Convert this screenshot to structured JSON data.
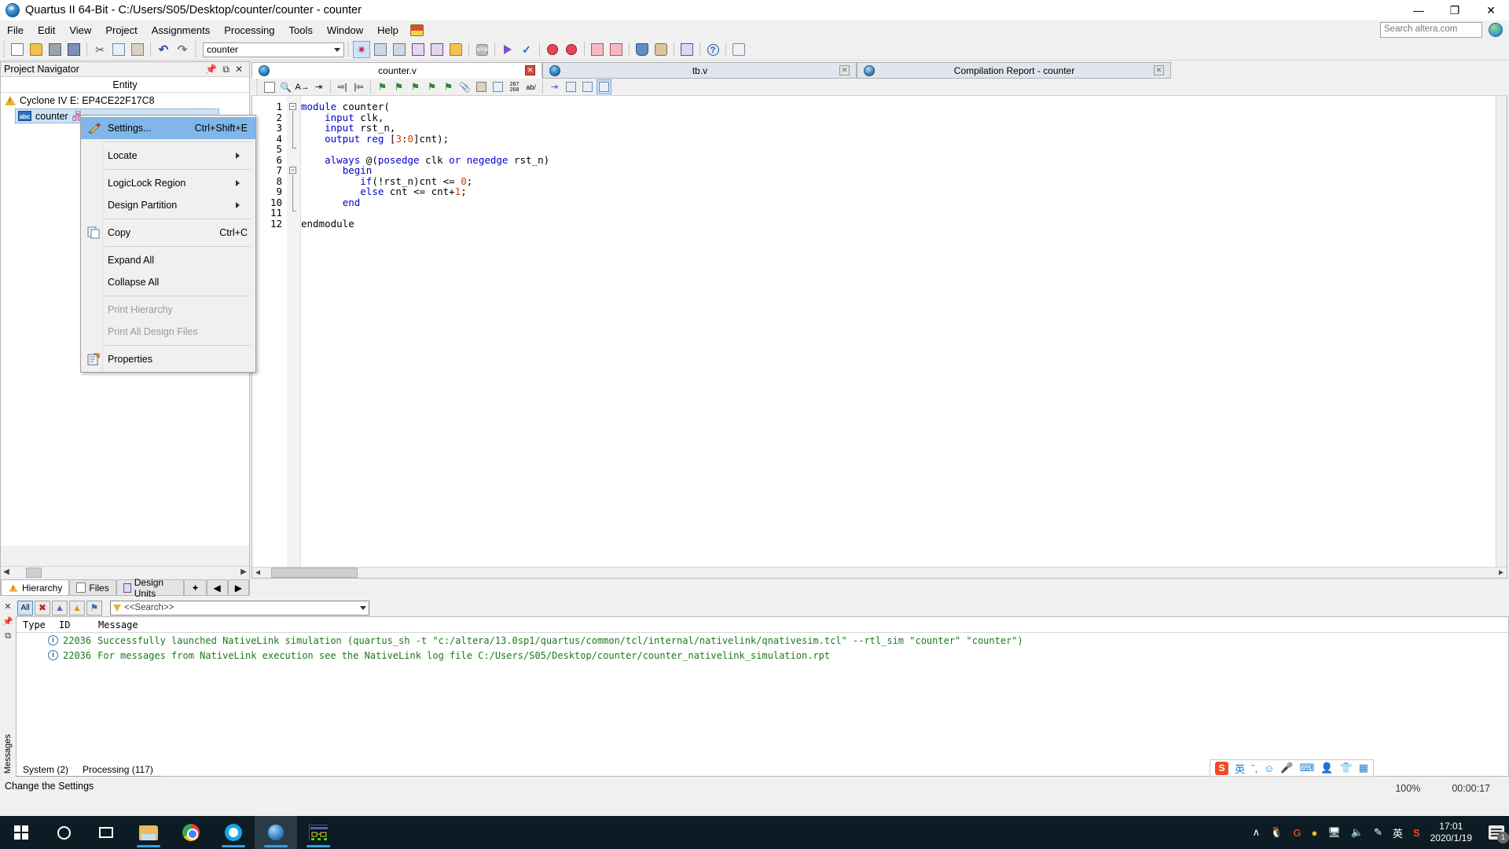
{
  "window": {
    "title": "Quartus II 64-Bit - C:/Users/S05/Desktop/counter/counter - counter",
    "app_icon": "quartus-globe-icon",
    "minimize": "—",
    "maximize": "❐",
    "close": "✕"
  },
  "menubar": {
    "items": [
      {
        "label": "File",
        "accel": "F"
      },
      {
        "label": "Edit",
        "accel": "E"
      },
      {
        "label": "View",
        "accel": "V"
      },
      {
        "label": "Project",
        "accel": "P"
      },
      {
        "label": "Assignments",
        "accel": "A"
      },
      {
        "label": "Processing",
        "accel": "r"
      },
      {
        "label": "Tools",
        "accel": "T"
      },
      {
        "label": "Window",
        "accel": "W"
      },
      {
        "label": "Help",
        "accel": "H"
      }
    ],
    "flag_icon": "language-flag-icon"
  },
  "search": {
    "placeholder": "Search altera.com",
    "value": "",
    "globe_icon": "globe-icon"
  },
  "toolbar": {
    "project_combo_value": "counter",
    "buttons": [
      {
        "name": "new-file-button",
        "icon": "new-document-icon"
      },
      {
        "name": "open-file-button",
        "icon": "open-folder-icon"
      },
      {
        "name": "save-button",
        "icon": "floppy-save-icon"
      },
      {
        "name": "save-all-button",
        "icon": "save-all-icon"
      },
      {
        "name": "cut-button",
        "icon": "scissors-icon"
      },
      {
        "name": "copy-button",
        "icon": "copy-icon"
      },
      {
        "name": "paste-button",
        "icon": "paste-icon"
      },
      {
        "name": "undo-button",
        "icon": "undo-arrow-icon"
      },
      {
        "name": "redo-button",
        "icon": "redo-arrow-icon"
      },
      {
        "name": "settings-button",
        "icon": "star-settings-icon"
      },
      {
        "name": "assignment-editor-button",
        "icon": "pencil-chip-icon"
      },
      {
        "name": "pin-planner-button",
        "icon": "pencil-icon"
      },
      {
        "name": "compile-edit-button",
        "icon": "chip-pencil-icon"
      },
      {
        "name": "netlist-viewer-button",
        "icon": "chip-blue-icon"
      },
      {
        "name": "programmer-button",
        "icon": "chip-gold-icon"
      },
      {
        "name": "stop-button",
        "icon": "stop-icon"
      },
      {
        "name": "start-compilation-button",
        "icon": "play-icon"
      },
      {
        "name": "start-analysis-button",
        "icon": "check-arrow-icon"
      },
      {
        "name": "timing-analyzer-button",
        "icon": "red-clock-icon"
      },
      {
        "name": "timequest-button",
        "icon": "red-clock2-icon"
      },
      {
        "name": "simulation-in-button",
        "icon": "waveform-in-icon"
      },
      {
        "name": "simulation-out-button",
        "icon": "waveform-out-icon"
      },
      {
        "name": "download-button",
        "icon": "download-chip-icon"
      },
      {
        "name": "hand-tool-button",
        "icon": "hand-icon"
      },
      {
        "name": "signaltap-button",
        "icon": "signaltap-icon"
      },
      {
        "name": "help-button",
        "icon": "help-circle-icon"
      },
      {
        "name": "message-button",
        "icon": "message-balloon-icon"
      }
    ]
  },
  "project_navigator": {
    "title": "Project Navigator",
    "tools": [
      "pin-icon",
      "restore-icon",
      "close-icon"
    ],
    "column_header": "Entity",
    "device": "Cyclone IV E: EP4CE22F17C8",
    "entity": "counter",
    "tabs": [
      {
        "label": "Hierarchy",
        "icon": "hierarchy-icon",
        "active": true
      },
      {
        "label": "Files",
        "icon": "files-icon",
        "active": false
      },
      {
        "label": "Design Units",
        "icon": "design-units-icon",
        "active": false
      }
    ]
  },
  "context_menu": {
    "items": [
      {
        "label": "Settings...",
        "accel": "S",
        "shortcut": "Ctrl+Shift+E",
        "icon": "settings-pencil-icon",
        "selected": true,
        "disabled": false
      },
      {
        "sep": true
      },
      {
        "label": "Locate",
        "submenu": true,
        "icon": null,
        "selected": false,
        "disabled": false
      },
      {
        "sep": true
      },
      {
        "label": "LogicLock Region",
        "submenu": true,
        "icon": null,
        "selected": false,
        "disabled": false
      },
      {
        "label": "Design Partition",
        "submenu": true,
        "icon": null,
        "selected": false,
        "disabled": false
      },
      {
        "sep": true
      },
      {
        "label": "Copy",
        "accel": "C",
        "shortcut": "Ctrl+C",
        "icon": "copy-icon",
        "selected": false,
        "disabled": false
      },
      {
        "sep": true
      },
      {
        "label": "Expand All",
        "accel": "x",
        "selected": false,
        "disabled": false
      },
      {
        "label": "Collapse All",
        "accel": "l",
        "selected": false,
        "disabled": false
      },
      {
        "sep": true
      },
      {
        "label": "Print Hierarchy",
        "accel": "H",
        "selected": false,
        "disabled": true
      },
      {
        "label": "Print All Design Files",
        "accel": "F",
        "selected": false,
        "disabled": true
      },
      {
        "sep": true
      },
      {
        "label": "Properties",
        "accel": "o",
        "icon": "properties-icon",
        "selected": false,
        "disabled": false
      }
    ]
  },
  "document_tabs": [
    {
      "label": "counter.v",
      "active": true,
      "close_red": true,
      "icon": "verilog-file-icon"
    },
    {
      "label": "tb.v",
      "active": false,
      "close_red": false,
      "icon": "verilog-file-icon"
    },
    {
      "label": "Compilation Report - counter",
      "active": false,
      "close_red": false,
      "icon": "report-icon"
    }
  ],
  "editor": {
    "line_numbers": [
      1,
      2,
      3,
      4,
      5,
      6,
      7,
      8,
      9,
      10,
      11,
      12
    ],
    "code": [
      "module counter(",
      "    input clk,",
      "    input rst_n,",
      "    output reg [3:0]cnt);",
      "",
      "    always @(posedge clk or negedge rst_n)",
      "       begin",
      "          if(!rst_n)cnt <= 0;",
      "          else cnt <= cnt+1;",
      "       end",
      "",
      "endmodule"
    ],
    "marks": {
      "line_col": "267\n268",
      "ab_label": "ab/"
    }
  },
  "messages": {
    "filter_buttons": [
      {
        "label": "All",
        "name": "filter-all",
        "active": true
      },
      {
        "label": "",
        "name": "filter-error",
        "icon": "error-icon"
      },
      {
        "label": "",
        "name": "filter-critical-warning",
        "icon": "critical-warning-icon"
      },
      {
        "label": "",
        "name": "filter-warning",
        "icon": "warning-icon"
      },
      {
        "label": "",
        "name": "filter-info",
        "icon": "info-flag-icon"
      }
    ],
    "search_placeholder": "<<Search>>",
    "search_value": "<<Search>>",
    "columns": [
      "Type",
      "ID",
      "Message"
    ],
    "rows": [
      {
        "type_icon": "info-icon",
        "id": "22036",
        "message": "Successfully launched NativeLink simulation (quartus_sh -t \"c:/altera/13.0sp1/quartus/common/tcl/internal/nativelink/qnativesim.tcl\" --rtl_sim \"counter\" \"counter\")"
      },
      {
        "type_icon": "info-icon",
        "id": "22036",
        "message": "For messages from NativeLink execution see the NativeLink log file C:/Users/S05/Desktop/counter/counter_nativelink_simulation.rpt"
      }
    ],
    "tabs": [
      {
        "label": "System (2)",
        "active": false
      },
      {
        "label": "Processing (117)",
        "active": true
      }
    ],
    "panel_label": "Messages"
  },
  "status_bar": {
    "text": "Change the Settings",
    "zoom": "100%",
    "elapsed": "00:00:17"
  },
  "ime": {
    "logo": "S",
    "items": [
      "英",
      "ˇ,",
      "☺",
      "mic-icon",
      "keyboard-icon",
      "user-icon",
      "shirt-icon",
      "apps-icon"
    ]
  },
  "taskbar": {
    "items": [
      {
        "name": "start-button",
        "icon": "windows-logo-icon"
      },
      {
        "name": "cortana-search-button",
        "icon": "search-circle-icon"
      },
      {
        "name": "task-view-button",
        "icon": "task-view-icon"
      },
      {
        "name": "file-explorer-button",
        "icon": "folder-icon",
        "running": true
      },
      {
        "name": "chrome-button",
        "icon": "chrome-icon",
        "running": false
      },
      {
        "name": "qq-button",
        "icon": "qq-icon",
        "running": true
      },
      {
        "name": "quartus-button",
        "icon": "quartus-icon",
        "running": true,
        "active": true
      },
      {
        "name": "modelsim-button",
        "icon": "rtl-viewer-icon",
        "running": true
      }
    ],
    "tray": {
      "chevron": "∧",
      "icons": [
        "penguin-icon",
        "360-icon",
        "yellow-shield-icon",
        "display-icon",
        "volume-muted-icon",
        "pen-icon",
        "ime-cn-icon",
        "sogou-icon"
      ],
      "time": "17:01",
      "date": "2020/1/19",
      "notification_count": "1"
    }
  },
  "colors": {
    "accent": "#2b6fc0",
    "menu_selection": "#80b6e8",
    "keyword": "#0000d0",
    "number": "#d04000",
    "message_green": "#1a7a1a",
    "taskbar_bg": "#0d1b24"
  }
}
